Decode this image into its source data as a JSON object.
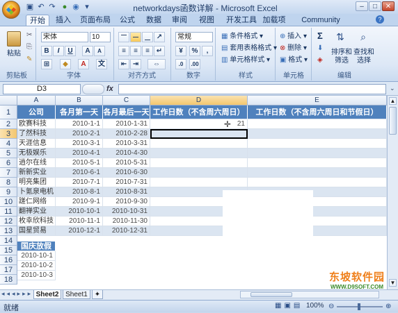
{
  "window": {
    "title": "networkdays函数详解 - Microsoft Excel"
  },
  "tabs": [
    "开始",
    "插入",
    "页面布局",
    "公式",
    "数据",
    "审阅",
    "视图",
    "开发工具",
    "加载项",
    "Community Clips"
  ],
  "ribbon": {
    "clipboard": {
      "label": "剪贴板",
      "paste": "粘贴"
    },
    "font": {
      "label": "字体",
      "name": "宋体",
      "size": "10",
      "bold": "B",
      "italic": "I",
      "underline": "U",
      "grow": "A",
      "shrink": "A"
    },
    "alignment": {
      "label": "对齐方式"
    },
    "number": {
      "label": "数字",
      "format": "常规",
      "percent": "%",
      "comma": ","
    },
    "styles": {
      "label": "样式",
      "conditional": "条件格式",
      "table": "套用表格格式",
      "cell": "单元格样式"
    },
    "cells": {
      "label": "单元格",
      "insert": "插入",
      "delete": "删除",
      "format": "格式"
    },
    "editing": {
      "label": "编辑",
      "sum": "Σ",
      "sort_line1": "排序和",
      "sort_line2": "筛选",
      "find_line1": "查找和",
      "find_line2": "选择"
    }
  },
  "formula_bar": {
    "name_box": "D3",
    "fx": "fx",
    "value": ""
  },
  "columns": [
    "A",
    "B",
    "C",
    "D",
    "E"
  ],
  "rows": [
    "1",
    "2",
    "3",
    "4",
    "5",
    "6",
    "7",
    "8",
    "9",
    "10",
    "11",
    "12",
    "13",
    "14",
    "15",
    "16",
    "17",
    "18"
  ],
  "table": {
    "headers": [
      "公司",
      "各月第一天",
      "各月最后一天",
      "工作日数（不含周六周日）",
      "工作日数（不含周六周日和节假日）"
    ],
    "data": [
      [
        "欧赛科技",
        "2010-1-1",
        "2010-1-31",
        "21",
        ""
      ],
      [
        "了然科技",
        "2010-2-1",
        "2010-2-28",
        "",
        ""
      ],
      [
        "天涯信息",
        "2010-3-1",
        "2010-3-31",
        "",
        ""
      ],
      [
        "无极娱乐",
        "2010-4-1",
        "2010-4-30",
        "",
        ""
      ],
      [
        "逍尔在线",
        "2010-5-1",
        "2010-5-31",
        "",
        ""
      ],
      [
        "新新实业",
        "2010-6-1",
        "2010-6-30",
        "",
        ""
      ],
      [
        "明亮集团",
        "2010-7-1",
        "2010-7-31",
        "",
        ""
      ],
      [
        "卜氪泉电机",
        "2010-8-1",
        "2010-8-31",
        "",
        ""
      ],
      [
        "蹉仁网络",
        "2010-9-1",
        "2010-9-30",
        "",
        ""
      ],
      [
        "翻禅实业",
        "2010-10-1",
        "2010-10-31",
        "",
        ""
      ],
      [
        "枚幸欣科技",
        "2010-11-1",
        "2010-11-30",
        "",
        ""
      ],
      [
        "国星贸易",
        "2010-12-1",
        "2010-12-31",
        "",
        ""
      ]
    ]
  },
  "holidays": {
    "header": "国庆放假",
    "dates": [
      "2010-10-1",
      "2010-10-2",
      "2010-10-3"
    ]
  },
  "sheets": [
    "Sheet2",
    "Sheet1"
  ],
  "status": {
    "ready": "就绪",
    "zoom": "100%"
  },
  "watermark": {
    "line1": "东坡软件园",
    "line2": "WWW.D9SOFT.COM"
  },
  "colors": {
    "header_fill": "#4f81bd",
    "band_fill": "#dbe5f1",
    "active_col": "#f9d99a"
  }
}
